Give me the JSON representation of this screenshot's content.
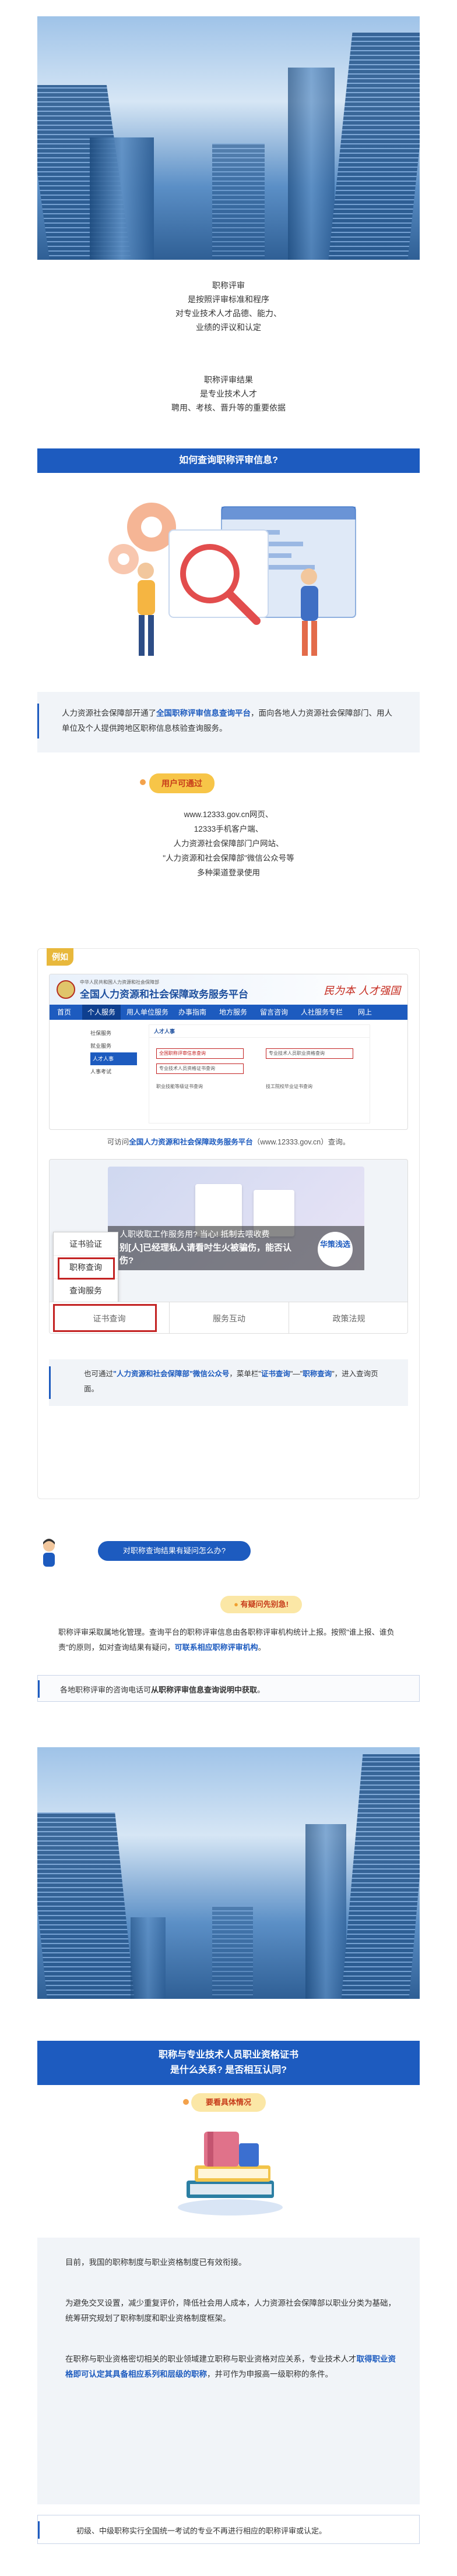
{
  "intro": {
    "lines1": [
      "职称评审",
      "是按照评审标准和程序",
      "对专业技术人才品德、能力、",
      "业绩的评议和认定"
    ],
    "lines2": [
      "职称评审结果",
      "是专业技术人才",
      "聘用、考核、晋升等的重要依据"
    ]
  },
  "section1": {
    "title": "如何查询职称评审信息?"
  },
  "para1": {
    "pre": "人力资源社会保障部开通了",
    "highlight": "全国职称评审信息查询平台",
    "post": "，面向各地人力资源社会保障部门、用人单位及个人提供跨地区职称信息核验查询服务。"
  },
  "access": {
    "badge": "用户可通过",
    "lines": [
      "www.12333.gov.cn网页、",
      "12333手机客户端、",
      "人力资源社会保障部门户网站、",
      "\"人力资源和社会保障部\"微信公众号等",
      "多种渠道登录使用"
    ]
  },
  "example": {
    "badge": "例如",
    "site": {
      "header_small": "中华人民共和国人力资源和社会保障部",
      "header_title": "全国人力资源和社会保障政务服务平台",
      "slogan": "民为本 人才强国",
      "tabs": [
        "首页",
        "个人服务",
        "用人单位服务",
        "办事指南",
        "地方服务",
        "留言咨询",
        "人社服务专栏",
        "网上"
      ],
      "side": [
        "社保服务",
        "就业服务",
        "人才人事",
        "人事考试"
      ],
      "panel_title": "人才人事",
      "rows": [
        "全国职称评审信息查询",
        "专业技术人员资格证书查询",
        "专业技术人员职业资格查询",
        "职业技能等级证书查询",
        "技工院校毕业证书查询"
      ]
    },
    "caption1": {
      "pre": "可访问",
      "highlight": "全国人力资源和社会保障政务服务平台",
      "post": "（www.12333.gov.cn）查询。"
    },
    "wechat": {
      "banner1": "人职收取工作服务用? 当心! 抵制去喂收费",
      "banner2": "别[人]已经理私人请看吋生火被骗伤，能否认",
      "banner3": "伤?",
      "badge": "华策浅选",
      "menu": [
        "证书验证",
        "职称查询",
        "查询服务"
      ],
      "tiles": [
        "证书查询",
        "服务互动",
        "政策法规"
      ]
    },
    "caption2": {
      "pre": "也可通过",
      "highlight1": "\"人力资源和社会保障部\"微信公众号",
      "mid": "，菜单栏\"",
      "highlight2": "证书查询",
      "mid2": "\"—\"",
      "highlight3": "职称查询",
      "post": "\"，进入查询页面。"
    }
  },
  "faq": {
    "question": "对职称查询结果有疑问怎么办?",
    "answer_label": "有疑问先别急!",
    "para": {
      "pre": "职称评审采取属地化管理。查询平台的职称评审信息由各职称评审机构统计上报。按照\"谁上报、谁负责\"的原则，如对查询结果有疑问，",
      "highlight": "可联系相应职称评审机构",
      "post": "。"
    },
    "note": {
      "pre": "各地职称评审的咨询电话可",
      "highlight": "从职称评审信息查询说明中获取",
      "post": "。"
    }
  },
  "section2": {
    "title_line1": "职称与专业技术人员职业资格证书",
    "title_line2": "是什么关系? 是否相互认同?"
  },
  "explain": {
    "badge": "要看具体情况",
    "p1": "目前，我国的职称制度与职业资格制度已有效衔接。",
    "p2": "为避免交叉设置，减少重复评价，降低社会用人成本，人力资源社会保障部以职业分类为基础，统筹研究规划了职称制度和职业资格制度框架。",
    "p3": {
      "pre": "在职称与职业资格密切相关的职业领域建立职称与职业资格对应关系，专业技术人才",
      "highlight": "取得职业资格即可认定其具备相应系列和层级的职称",
      "post": "，并可作为申报高一级职称的条件。"
    },
    "p4": "初级、中级职称实行全国统一考试的专业不再进行相应的职称评审或认定。"
  },
  "colors": {
    "primary": "#1d5bbf",
    "accent": "#f3a24b",
    "badge_yellow": "#f7c548",
    "red": "#c32222"
  }
}
